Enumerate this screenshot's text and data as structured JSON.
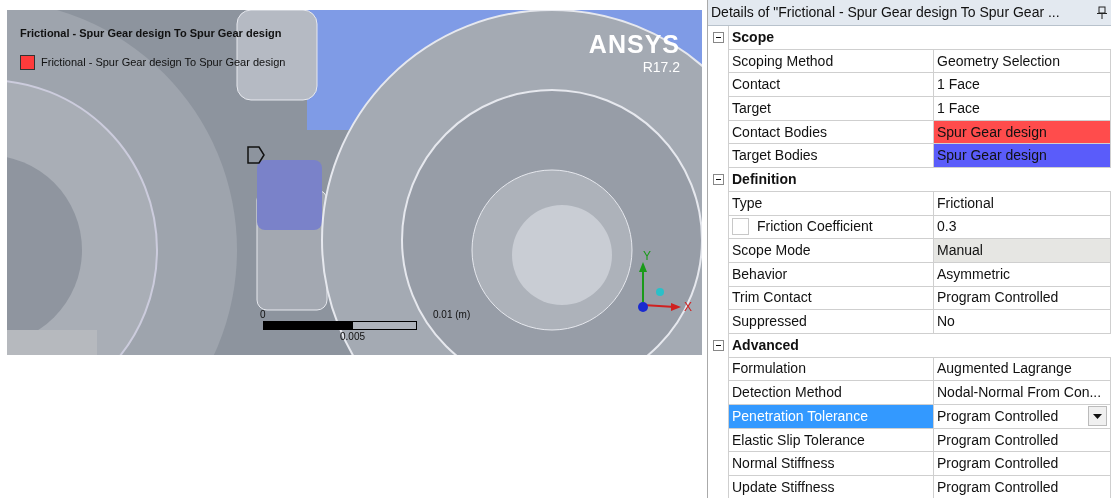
{
  "viewport": {
    "legend": {
      "title": "Frictional - Spur Gear design To Spur Gear design",
      "entries": [
        {
          "label": "Frictional - Spur Gear design To Spur Gear design",
          "color": "#ff3b3b"
        }
      ]
    },
    "logo": {
      "name": "ANSYS",
      "version": "R17.2"
    },
    "scale_bar": {
      "start": "0",
      "end": "0.01 (m)",
      "mid": "0.005"
    },
    "triad": {
      "y_label": "Y",
      "x_label": "X"
    }
  },
  "details": {
    "title": "Details of \"Frictional - Spur Gear design To Spur Gear ...",
    "sections": [
      {
        "label": "Scope",
        "expanded": true,
        "rows": [
          {
            "label": "Scoping Method",
            "value": "Geometry Selection",
            "selected": false
          },
          {
            "label": "Contact",
            "value": "1 Face",
            "selected": false
          },
          {
            "label": "Target",
            "value": "1 Face",
            "selected": false
          },
          {
            "label": "Contact Bodies",
            "value": "Spur Gear design",
            "selected": false,
            "color": "#ff4c4c"
          },
          {
            "label": "Target Bodies",
            "value": "Spur Gear design",
            "selected": false,
            "color": "#5a5cfa"
          }
        ]
      },
      {
        "label": "Definition",
        "expanded": true,
        "rows": [
          {
            "label": "Type",
            "value": "Frictional",
            "selected": false
          },
          {
            "label": "Friction Coefficient",
            "value": "0.3",
            "selected": false,
            "checked": false
          },
          {
            "label": "Scope Mode",
            "value": "Manual",
            "selected": false,
            "read_only": true
          },
          {
            "label": "Behavior",
            "value": "Asymmetric",
            "selected": false
          },
          {
            "label": "Trim Contact",
            "value": "Program Controlled",
            "selected": false
          },
          {
            "label": "Suppressed",
            "value": "No",
            "selected": false
          }
        ]
      },
      {
        "label": "Advanced",
        "expanded": true,
        "rows": [
          {
            "label": "Formulation",
            "value": "Augmented Lagrange",
            "selected": false
          },
          {
            "label": "Detection Method",
            "value": "Nodal-Normal From Con...",
            "selected": false
          },
          {
            "label": "Penetration Tolerance",
            "value": "Program Controlled",
            "selected": true,
            "dropdown": true
          },
          {
            "label": "Elastic Slip Tolerance",
            "value": "Program Controlled",
            "selected": false
          },
          {
            "label": "Normal Stiffness",
            "value": "Program Controlled",
            "selected": false
          },
          {
            "label": "Update Stiffness",
            "value": "Program Controlled",
            "selected": false
          }
        ]
      }
    ]
  }
}
